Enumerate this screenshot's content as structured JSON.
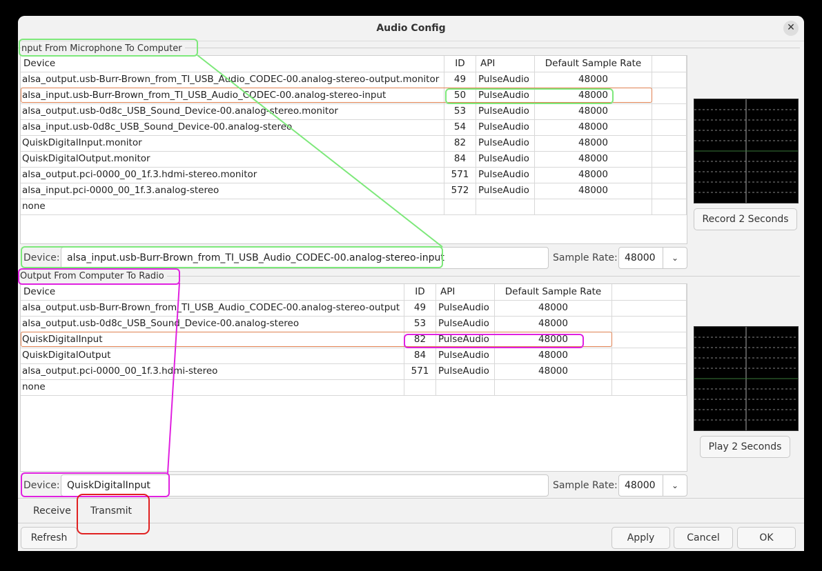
{
  "window": {
    "title": "Audio Config"
  },
  "input": {
    "group_label": "nput From Microphone To Computer",
    "columns": [
      "Device",
      "ID",
      "API",
      "Default Sample Rate"
    ],
    "rows": [
      {
        "device": "alsa_output.usb-Burr-Brown_from_TI_USB_Audio_CODEC-00.analog-stereo-output.monitor",
        "id": "49",
        "api": "PulseAudio",
        "rate": "48000"
      },
      {
        "device": "alsa_input.usb-Burr-Brown_from_TI_USB_Audio_CODEC-00.analog-stereo-input",
        "id": "50",
        "api": "PulseAudio",
        "rate": "48000"
      },
      {
        "device": "alsa_output.usb-0d8c_USB_Sound_Device-00.analog-stereo.monitor",
        "id": "53",
        "api": "PulseAudio",
        "rate": "48000"
      },
      {
        "device": "alsa_input.usb-0d8c_USB_Sound_Device-00.analog-stereo",
        "id": "54",
        "api": "PulseAudio",
        "rate": "48000"
      },
      {
        "device": "QuiskDigitalInput.monitor",
        "id": "82",
        "api": "PulseAudio",
        "rate": "48000"
      },
      {
        "device": "QuiskDigitalOutput.monitor",
        "id": "84",
        "api": "PulseAudio",
        "rate": "48000"
      },
      {
        "device": "alsa_output.pci-0000_00_1f.3.hdmi-stereo.monitor",
        "id": "571",
        "api": "PulseAudio",
        "rate": "48000"
      },
      {
        "device": "alsa_input.pci-0000_00_1f.3.analog-stereo",
        "id": "572",
        "api": "PulseAudio",
        "rate": "48000"
      },
      {
        "device": "none",
        "id": "",
        "api": "",
        "rate": ""
      }
    ],
    "device_label": "Device:",
    "device_value": "alsa_input.usb-Burr-Brown_from_TI_USB_Audio_CODEC-00.analog-stereo-input",
    "rate_label": "Sample Rate:",
    "rate_value": "48000",
    "button": "Record 2 Seconds"
  },
  "output": {
    "group_label": "Output From Computer To Radio",
    "columns": [
      "Device",
      "ID",
      "API",
      "Default Sample Rate"
    ],
    "rows": [
      {
        "device": "alsa_output.usb-Burr-Brown_from_TI_USB_Audio_CODEC-00.analog-stereo-output",
        "id": "49",
        "api": "PulseAudio",
        "rate": "48000"
      },
      {
        "device": "alsa_output.usb-0d8c_USB_Sound_Device-00.analog-stereo",
        "id": "53",
        "api": "PulseAudio",
        "rate": "48000"
      },
      {
        "device": "QuiskDigitalInput",
        "id": "82",
        "api": "PulseAudio",
        "rate": "48000"
      },
      {
        "device": "QuiskDigitalOutput",
        "id": "84",
        "api": "PulseAudio",
        "rate": "48000"
      },
      {
        "device": "alsa_output.pci-0000_00_1f.3.hdmi-stereo",
        "id": "571",
        "api": "PulseAudio",
        "rate": "48000"
      },
      {
        "device": "none",
        "id": "",
        "api": "",
        "rate": ""
      }
    ],
    "device_label": "Device:",
    "device_value": "QuiskDigitalInput",
    "rate_label": "Sample Rate:",
    "rate_value": "48000",
    "button": "Play 2 Seconds"
  },
  "tabs": [
    "Receive",
    "Transmit"
  ],
  "footer": {
    "refresh": "Refresh",
    "apply": "Apply",
    "cancel": "Cancel",
    "ok": "OK"
  },
  "icons": {
    "close": "close-icon",
    "dropdown": "chevron-down-icon"
  },
  "colors": {
    "annotation_green": "#7de87a",
    "annotation_magenta": "#e020e0",
    "annotation_red": "#e02020",
    "selection": "#e08050"
  }
}
